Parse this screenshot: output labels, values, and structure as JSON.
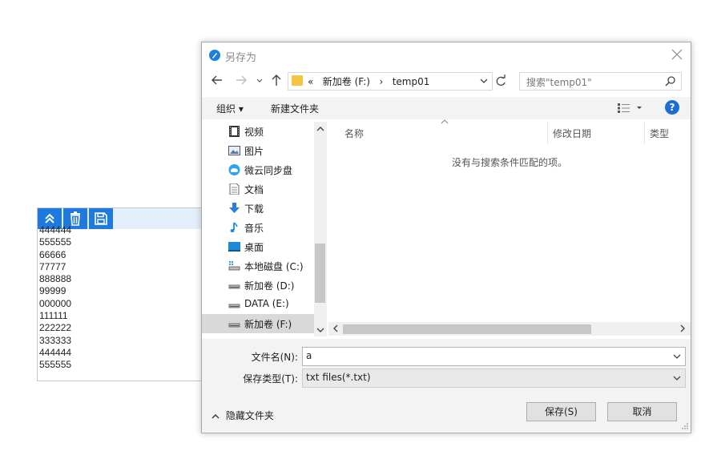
{
  "bg_panel": {
    "list": [
      "444444",
      "555555",
      "66666",
      "77777",
      "888888",
      "99999",
      "000000",
      "111111",
      "222222",
      "333333",
      "444444",
      "555555"
    ]
  },
  "dialog": {
    "title": "另存为",
    "address": {
      "chevrons": "«",
      "crumbs": [
        "新加卷 (F:)",
        "temp01"
      ],
      "separator": "›"
    },
    "search_placeholder": "搜索\"temp01\"",
    "cmdbar": {
      "organize": "组织 ▾",
      "new_folder": "新建文件夹"
    },
    "help": "?",
    "nav_items": [
      {
        "label": "视频",
        "icon": "video-icon"
      },
      {
        "label": "图片",
        "icon": "picture-icon"
      },
      {
        "label": "微云同步盘",
        "icon": "weiyun-icon"
      },
      {
        "label": "文档",
        "icon": "document-icon"
      },
      {
        "label": "下载",
        "icon": "download-icon"
      },
      {
        "label": "音乐",
        "icon": "music-icon"
      },
      {
        "label": "桌面",
        "icon": "desktop-icon"
      },
      {
        "label": "本地磁盘 (C:)",
        "icon": "os-drive-icon"
      },
      {
        "label": "新加卷 (D:)",
        "icon": "drive-icon"
      },
      {
        "label": "DATA (E:)",
        "icon": "drive-icon"
      },
      {
        "label": "新加卷 (F:)",
        "icon": "drive-icon",
        "selected": true
      }
    ],
    "columns": {
      "name": "名称",
      "modified": "修改日期",
      "type": "类型"
    },
    "empty_message": "没有与搜索条件匹配的项。",
    "filename_label": "文件名(N):",
    "filename_value": "a",
    "filetype_label": "保存类型(T):",
    "filetype_value": "txt files(*.txt)",
    "hide_folders": "隐藏文件夹",
    "save_button": "保存(S)",
    "cancel_button": "取消"
  },
  "colors": {
    "accent": "#1f7ae0",
    "selection": "#d9d9d9",
    "cmdbar": "#f3f3f3"
  }
}
